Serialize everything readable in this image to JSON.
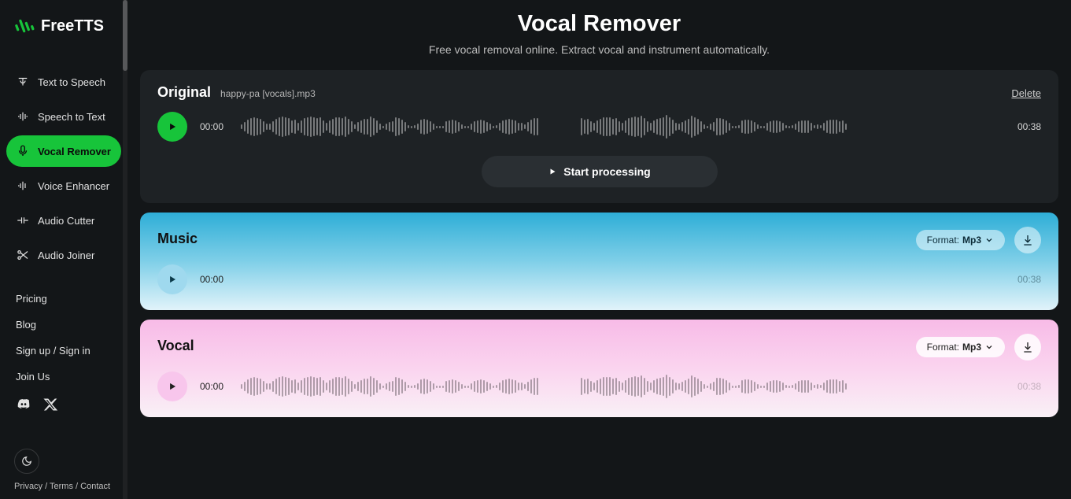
{
  "brand": "FreeTTS",
  "sidebar": {
    "items": [
      {
        "label": "Text to Speech"
      },
      {
        "label": "Speech to Text"
      },
      {
        "label": "Vocal Remover"
      },
      {
        "label": "Voice Enhancer"
      },
      {
        "label": "Audio Cutter"
      },
      {
        "label": "Audio Joiner"
      }
    ],
    "secondary": [
      {
        "label": "Pricing"
      },
      {
        "label": "Blog"
      },
      {
        "label": "Sign up / Sign in"
      },
      {
        "label": "Join Us"
      }
    ],
    "policies": "Privacy / Terms / Contact"
  },
  "header": {
    "title": "Vocal Remover",
    "subtitle": "Free vocal removal online. Extract vocal and instrument automatically."
  },
  "original": {
    "title": "Original",
    "filename": "happy-pa [vocals].mp3",
    "delete_label": "Delete",
    "start_time": "00:00",
    "end_time": "00:38",
    "process_label": "Start processing"
  },
  "music": {
    "title": "Music",
    "format_prefix": "Format: ",
    "format_value": "Mp3",
    "start_time": "00:00",
    "end_time": "00:38"
  },
  "vocal": {
    "title": "Vocal",
    "format_prefix": "Format: ",
    "format_value": "Mp3",
    "start_time": "00:00",
    "end_time": "00:38"
  }
}
